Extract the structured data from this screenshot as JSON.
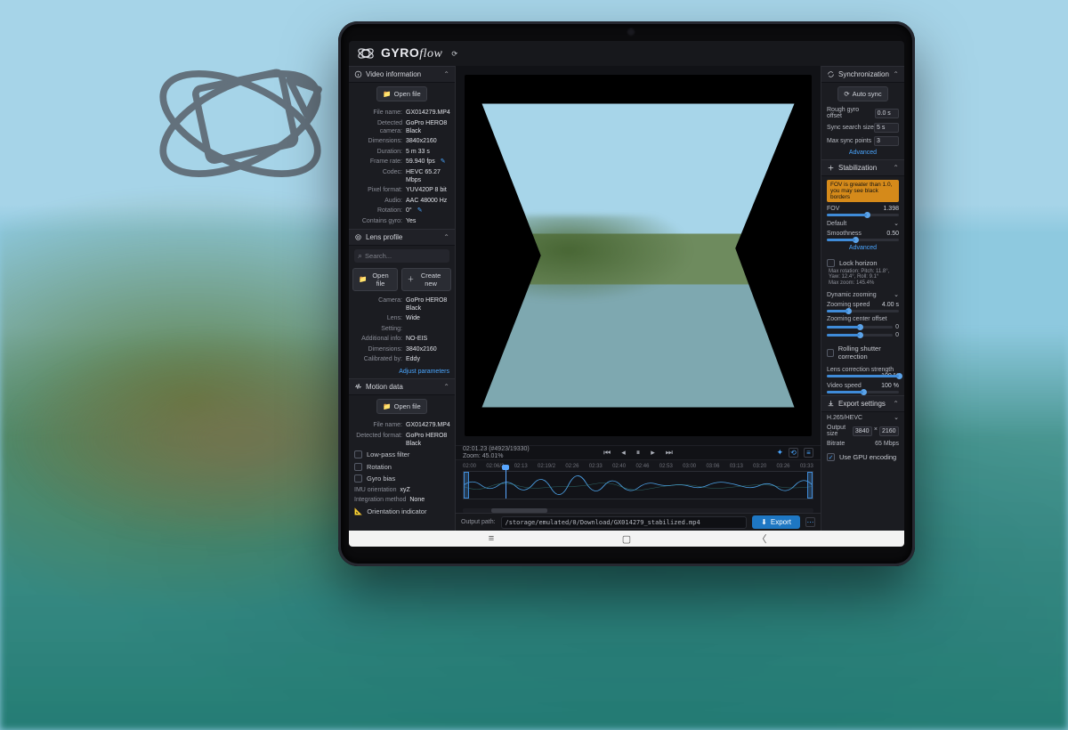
{
  "brand": {
    "namePart1": "GYRO",
    "namePart2": "flow"
  },
  "sync": {
    "title": "Synchronization",
    "auto_label": "Auto sync",
    "rough_label": "Rough gyro offset",
    "rough_val": "0.0 s",
    "search_label": "Sync search size",
    "search_val": "5 s",
    "max_points_label": "Max sync points",
    "max_points_val": "3",
    "advanced": "Advanced"
  },
  "stab": {
    "title": "Stabilization",
    "warning": "FOV is greater than 1.0, you may see black borders",
    "fov_label": "FOV",
    "fov_val": "1.398",
    "default_label": "Default",
    "smooth_label": "Smoothness",
    "smooth_val": "0.50",
    "advanced": "Advanced",
    "lock_horizon": "Lock horizon",
    "rotation_info": "Max rotation: Pitch: 11.8°, Yaw: 12.4°, Roll: 9.1°",
    "zoom_info": "Max zoom: 145.4%",
    "dynamic_zoom": "Dynamic zooming",
    "zoom_speed_label": "Zooming speed",
    "zoom_speed_val": "4.00 s",
    "zoom_center_label": "Zooming center offset",
    "zoom_center_x": "0",
    "zoom_center_y": "0",
    "rolling": "Rolling shutter correction",
    "lens_strength_label": "Lens correction strength",
    "lens_strength_val": "100 %",
    "video_speed_label": "Video speed",
    "video_speed_val": "100 %"
  },
  "export": {
    "title": "Export settings",
    "codec": "H.265/HEVC",
    "output_size_label": "Output size",
    "size_w": "3840",
    "size_h": "2160",
    "bitrate_label": "Bitrate",
    "bitrate": "65 Mbps",
    "gpu": "Use GPU encoding"
  },
  "video": {
    "title": "Video information",
    "open": "Open file",
    "file_label": "File name:",
    "file": "GX014279.MP4",
    "cam_label": "Detected camera:",
    "cam": "GoPro HERO8 Black",
    "dim_label": "Dimensions:",
    "dim": "3840x2160",
    "dur_label": "Duration:",
    "dur": "5 m 33 s",
    "fps_label": "Frame rate:",
    "fps": "59.940 fps",
    "codec_label": "Codec:",
    "codec": "HEVC 65.27 Mbps",
    "pix_label": "Pixel format:",
    "pix": "YUV420P 8 bit",
    "audio_label": "Audio:",
    "audio": "AAC 48000 Hz",
    "rot_label": "Rotation:",
    "rot": "0°",
    "gyro_label": "Contains gyro:",
    "gyro": "Yes"
  },
  "lens": {
    "title": "Lens profile",
    "search_placeholder": "Search...",
    "open": "Open file",
    "create": "Create new",
    "cam_label": "Camera:",
    "cam": "GoPro HERO8 Black",
    "lens_label": "Lens:",
    "lens": "Wide",
    "setting_label": "Setting:",
    "addl_label": "Additional info:",
    "addl": "NO-EIS",
    "dim_label": "Dimensions:",
    "dim": "3840x2160",
    "cal_label": "Calibrated by:",
    "cal": "Eddy",
    "adjust": "Adjust parameters"
  },
  "motion": {
    "title": "Motion data",
    "open": "Open file",
    "file_label": "File name:",
    "file": "GX014279.MP4",
    "fmt_label": "Detected format:",
    "fmt": "GoPro HERO8 Black",
    "lp": "Low-pass filter",
    "rot": "Rotation",
    "bias": "Gyro bias",
    "imu_label": "IMU orientation",
    "imu": "xyZ",
    "integ_label": "Integration method",
    "integ": "None",
    "orient": "Orientation indicator"
  },
  "playback": {
    "timecode": "02:01.23 (#4923/19330)",
    "zoom": "Zoom: 45.01%",
    "ticks": [
      "02:00",
      "02:06/2",
      "02:13",
      "02:19/2",
      "02:26",
      "02:33",
      "02:40",
      "02:46",
      "02:53",
      "03:00",
      "03:06",
      "03:13",
      "03:20",
      "03:26",
      "03:33"
    ]
  },
  "footer": {
    "out_label": "Output path:",
    "path": "/storage/emulated/0/Download/GX014279_stabilized.mp4",
    "export": "Export"
  }
}
